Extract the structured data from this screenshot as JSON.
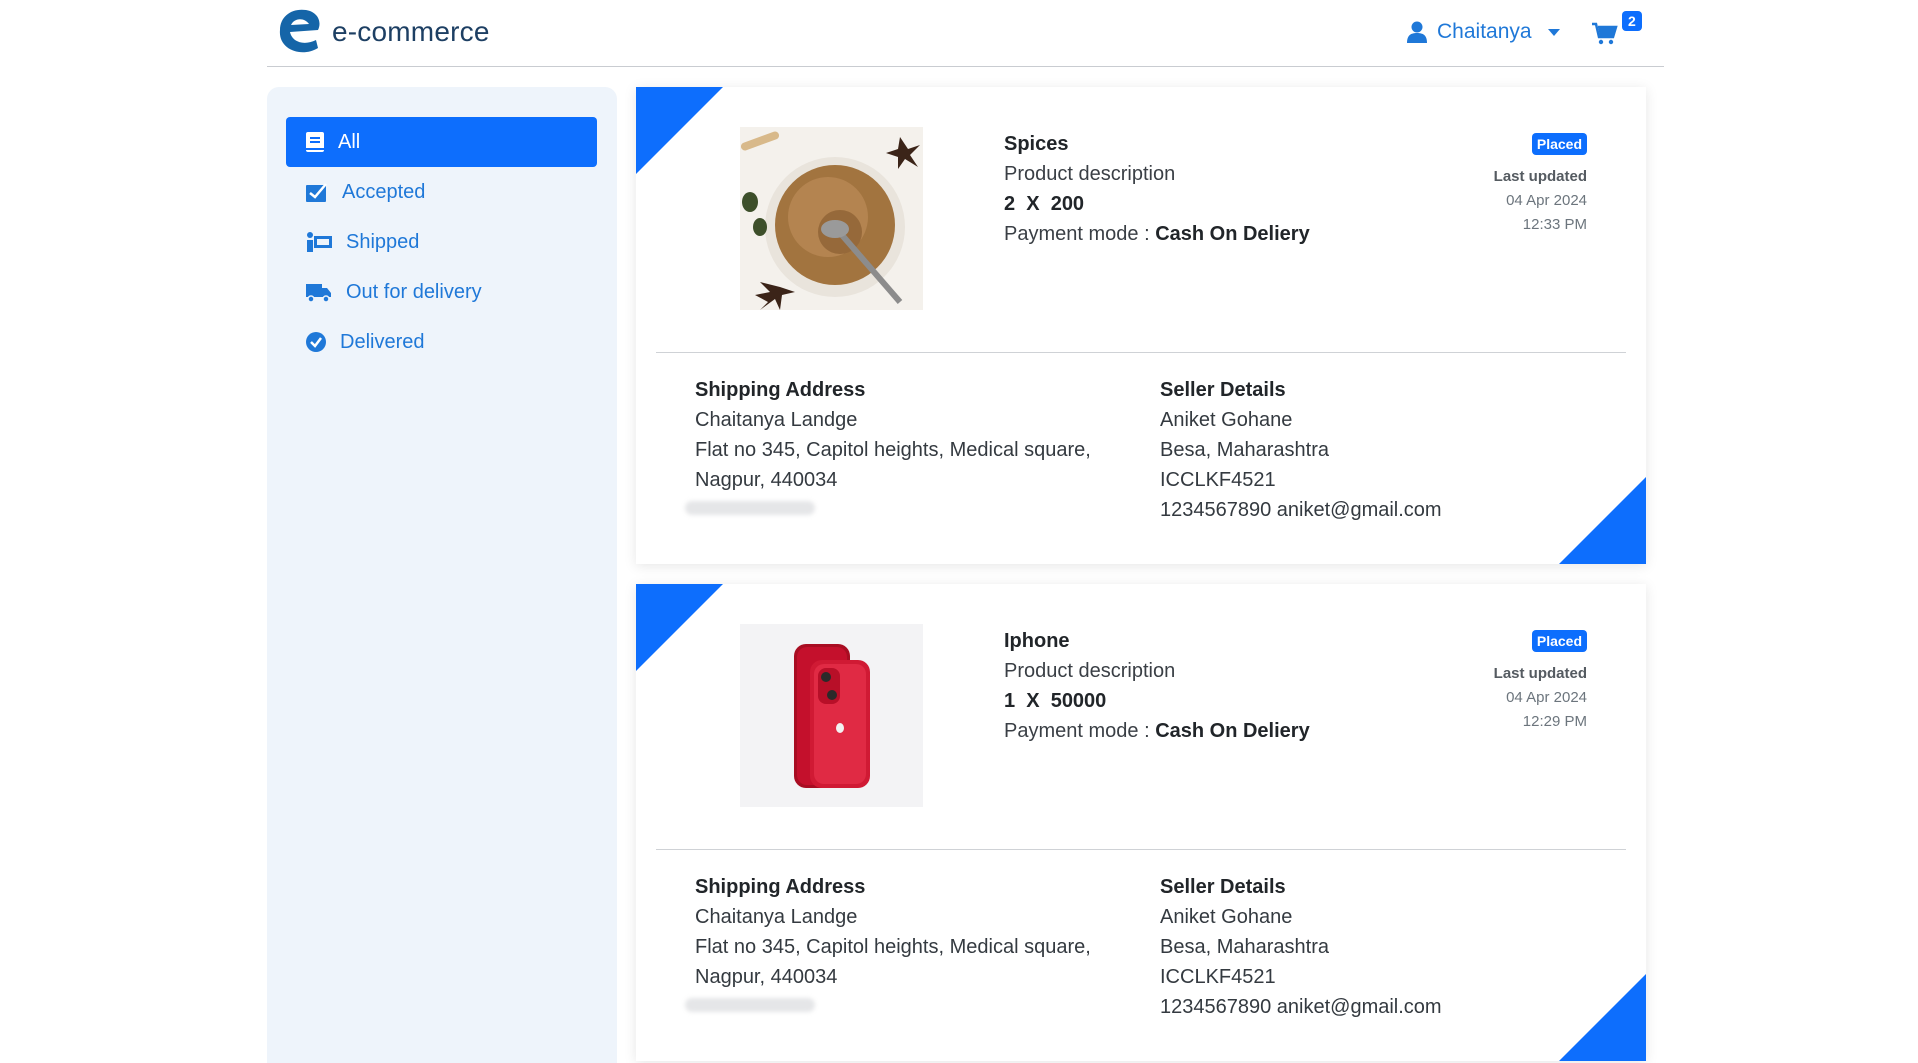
{
  "header": {
    "brand": "e-commerce",
    "user_name": "Chaitanya",
    "cart_count": "2"
  },
  "sidebar": {
    "items": [
      {
        "label": "All",
        "icon": "book-icon",
        "active": true
      },
      {
        "label": "Accepted",
        "icon": "check-square-icon"
      },
      {
        "label": "Shipped",
        "icon": "shipping-icon"
      },
      {
        "label": "Out for delivery",
        "icon": "truck-icon"
      },
      {
        "label": "Delivered",
        "icon": "check-circle-icon"
      }
    ]
  },
  "orders": [
    {
      "product_name": "Spices",
      "description": "Product description",
      "quantity_price": "2  X  200",
      "payment_label": "Payment mode : ",
      "payment_mode": "Cash On Deliery",
      "status": "Placed",
      "last_updated_label": "Last updated",
      "date": "04 Apr 2024",
      "time": "12:33 PM",
      "image": "spices-photo",
      "shipping": {
        "title": "Shipping Address",
        "name": "Chaitanya Landge",
        "line1": "Flat no 345, Capitol heights, Medical square,",
        "line2": "Nagpur, 440034"
      },
      "seller": {
        "title": "Seller Details",
        "name": "Aniket Gohane",
        "location": "Besa, Maharashtra",
        "code": "ICCLKF4521",
        "contact": "1234567890 aniket@gmail.com"
      }
    },
    {
      "product_name": "Iphone",
      "description": "Product description",
      "quantity_price": "1  X  50000",
      "payment_label": "Payment mode : ",
      "payment_mode": "Cash On Deliery",
      "status": "Placed",
      "last_updated_label": "Last updated",
      "date": "04 Apr 2024",
      "time": "12:29 PM",
      "image": "iphone-photo",
      "shipping": {
        "title": "Shipping Address",
        "name": "Chaitanya Landge",
        "line1": "Flat no 345, Capitol heights, Medical square,",
        "line2": "Nagpur, 440034"
      },
      "seller": {
        "title": "Seller Details",
        "name": "Aniket Gohane",
        "location": "Besa, Maharashtra",
        "code": "ICCLKF4521",
        "contact": "1234567890 aniket@gmail.com"
      }
    }
  ],
  "colors": {
    "primary": "#0d6efd",
    "link": "#1f78d8",
    "sidebar_bg": "#eef4fb",
    "brand_text": "#1d3f63"
  }
}
